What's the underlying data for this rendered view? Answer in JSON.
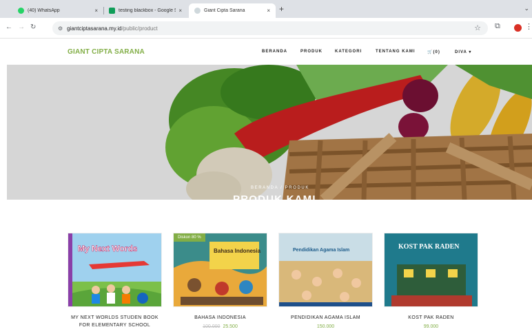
{
  "browser": {
    "tabs": [
      {
        "title": "(40) WhatsApp",
        "close": "×"
      },
      {
        "title": "testing blackbox - Google Sh",
        "close": "×"
      },
      {
        "title": "Giant Cipta Sarana",
        "close": "×"
      }
    ],
    "new_tab": "+",
    "url_host": "giantciptasarana.my.id",
    "url_path": "/public/product"
  },
  "site": {
    "brand": "GIANT CIPTA SARANA",
    "menu": [
      "BERANDA",
      "PRODUK",
      "KATEGORI",
      "TENTANG KAMI"
    ],
    "cart": "(0)",
    "user": "DIVA ▾"
  },
  "hero": {
    "breadcrumb": "BERANDA / PRODUK",
    "title": "PRODUK KAMI"
  },
  "products": [
    {
      "name": "MY NEXT WORLDS STUDEN BOOK FOR ELEMENTARY SCHOOL",
      "price": "",
      "old_price": "",
      "badge": "",
      "cover_text": "My Next Words"
    },
    {
      "name": "BAHASA INDONESIA",
      "price": "25.500",
      "old_price": "100.000",
      "badge": "Diskon 80 %",
      "cover_text": "Bahasa Indonesia"
    },
    {
      "name": "PENDIDIKAN AGAMA ISLAM",
      "price": "150.000",
      "old_price": "",
      "badge": "",
      "cover_text": "Pendidikan Agama Islam"
    },
    {
      "name": "KOST PAK RADEN",
      "price": "99.000",
      "old_price": "",
      "badge": "",
      "cover_text": "KOST PAK RADEN"
    }
  ],
  "colors": {
    "brand": "#82ae46"
  }
}
